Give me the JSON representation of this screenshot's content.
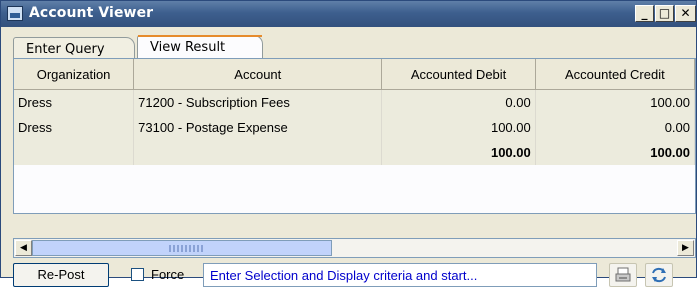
{
  "window": {
    "title": "Account Viewer",
    "controls": {
      "minimize": "_",
      "maximize": "□",
      "close": "✕"
    }
  },
  "tabs": [
    {
      "label": "Enter Query",
      "active": false
    },
    {
      "label": "View Result",
      "active": true
    }
  ],
  "table": {
    "columns": [
      "Organization",
      "Account",
      "Accounted Debit",
      "Accounted Credit"
    ],
    "rows": [
      {
        "organization": "Dress",
        "account": "71200 - Subscription Fees",
        "debit": "0.00",
        "credit": "100.00"
      },
      {
        "organization": "Dress",
        "account": "73100 - Postage Expense",
        "debit": "100.00",
        "credit": "0.00"
      }
    ],
    "totals": {
      "debit": "100.00",
      "credit": "100.00"
    }
  },
  "scrollbar": {
    "left_arrow": "◀",
    "right_arrow": "▶"
  },
  "statusbar": {
    "repost_label": "Re-Post",
    "force_label": "Force",
    "force_checked": false,
    "message": "Enter Selection and Display criteria and start...",
    "print_icon": "print-icon",
    "refresh_icon": "refresh-icon"
  },
  "colors": {
    "title_bar": "#3d5f8e",
    "message_text": "#0000cc",
    "active_tab_accent": "#e68b2c"
  }
}
